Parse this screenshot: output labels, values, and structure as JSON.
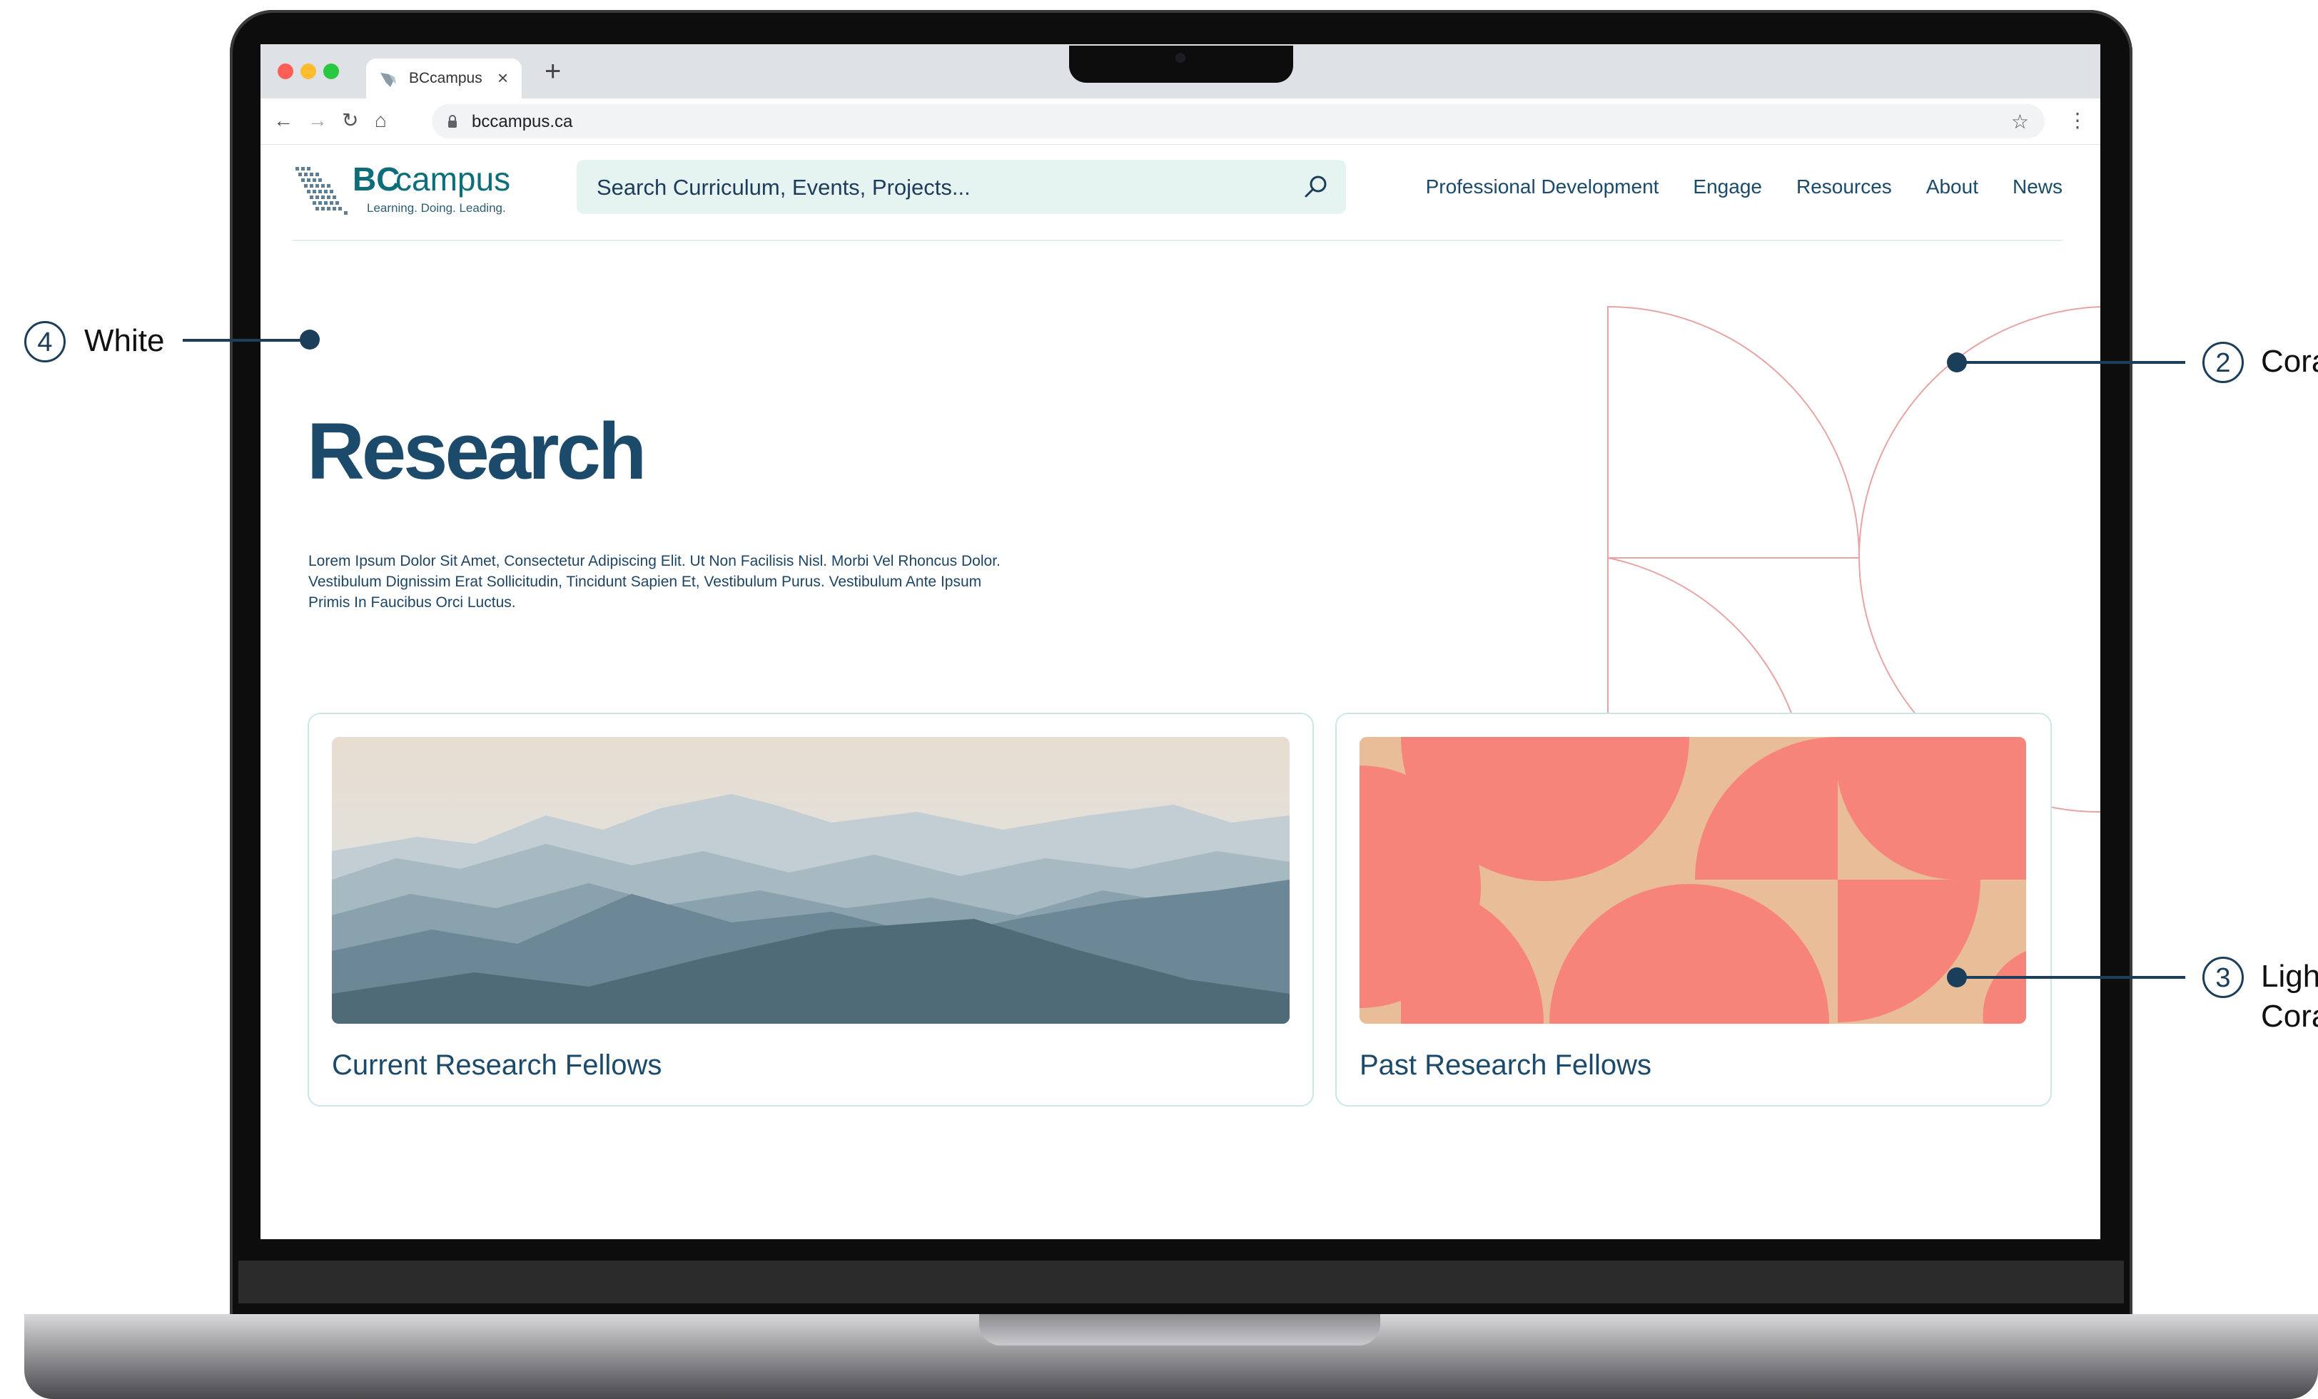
{
  "browser": {
    "tab_title": "BCcampus",
    "tab_close": "×",
    "new_tab": "+",
    "back": "←",
    "forward": "→",
    "reload": "↻",
    "home": "⌂",
    "url": "bccampus.ca",
    "star": "☆",
    "menu": "⋮",
    "traffic_colors": [
      "#ff5f57",
      "#febc2e",
      "#28c840"
    ]
  },
  "site": {
    "logo_bc": "BC",
    "logo_campus": "campus",
    "logo_tagline": "Learning. Doing. Leading.",
    "search_placeholder": "Search Curriculum, Events, Projects...",
    "nav": [
      "Professional Development",
      "Engage",
      "Resources",
      "About",
      "News"
    ]
  },
  "hero": {
    "title": "Research",
    "description": "Lorem Ipsum Dolor Sit Amet, Consectetur Adipiscing Elit. Ut Non Facilisis Nisl. Morbi Vel Rhoncus Dolor. Vestibulum Dignissim Erat Sollicitudin, Tincidunt Sapien Et, Vestibulum Purus. Vestibulum Ante Ipsum Primis In Faucibus Orci Luctus."
  },
  "cards": [
    {
      "title": "Current Research Fellows",
      "image": "misty-mountains"
    },
    {
      "title": "Past Research Fellows",
      "image": "coral-geometric-pattern"
    }
  ],
  "annotations": [
    {
      "number": "4",
      "label": "White"
    },
    {
      "number": "2",
      "label": "Cora"
    },
    {
      "number": "3",
      "label_line1": "Ligh",
      "label_line2": "Cora"
    }
  ],
  "colors": {
    "brand_teal": "#0d6d78",
    "navy": "#1b4a6b",
    "coral": "#f7847b",
    "light_coral": "#e8bd98",
    "search_bg": "#e6f4f1"
  }
}
